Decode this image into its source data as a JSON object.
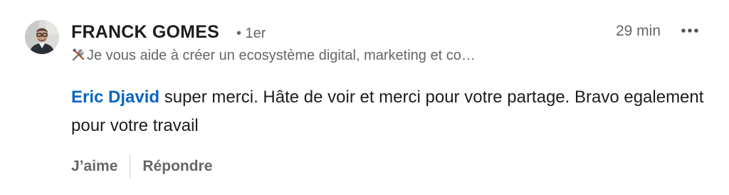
{
  "comment": {
    "author": {
      "name": "FRANCK GOMES",
      "degree": "• 1er",
      "headline_icon": "tools-icon",
      "headline": "Je vous aide à créer un ecosystème digital, marketing et co…",
      "avatar_icon": "user-avatar"
    },
    "timestamp": "29 min",
    "more_icon": "more-horizontal-icon",
    "body": {
      "mention": "Eric Djavid",
      "text": " super merci. Hâte de voir et merci pour votre partage. Bravo egalement pour votre travail"
    },
    "actions": {
      "like_label": "J’aime",
      "reply_label": "Répondre"
    }
  },
  "colors": {
    "mention": "#0a66c2",
    "secondary_text": "#666666",
    "primary_text": "#1d1d1d"
  }
}
